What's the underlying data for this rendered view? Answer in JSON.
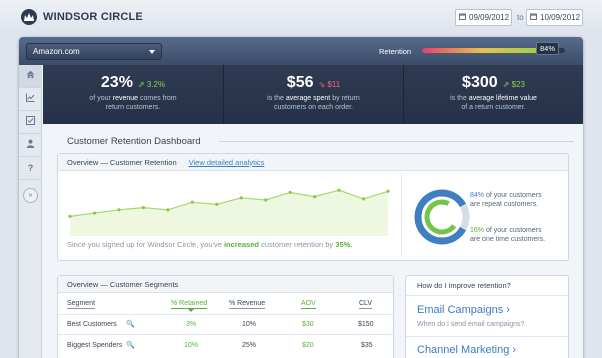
{
  "brand": {
    "name": "WINDSOR CIRCLE"
  },
  "dates": {
    "from": "09/09/2012",
    "to_label": "to",
    "to": "10/09/2012"
  },
  "header": {
    "store": "Amazon.com",
    "retention_label": "Retention",
    "retention_value": "84%",
    "retention_fraction": 0.84
  },
  "sidebar": {
    "icons": [
      "home-icon",
      "chart-icon",
      "checklist-icon",
      "user-icon",
      "help-icon",
      "expand-icon"
    ]
  },
  "stats": [
    {
      "value": "23%",
      "change": "3.2%",
      "line1_pre": "of your",
      "line1_bold": "revenue",
      "line1_post": "comes from",
      "line2": "return customers."
    },
    {
      "value": "$56",
      "change": "$11",
      "line1_pre": "is the",
      "line1_bold": "average spent",
      "line1_post": "by return",
      "line2": "customers on each order."
    },
    {
      "value": "$300",
      "change": "$23",
      "line1_pre": "is the",
      "line1_bold": "average lifetime value",
      "line1_post": "",
      "line2": "of a return customer."
    }
  ],
  "colors": {
    "up": "#8ed14b",
    "down": "#f06a6a",
    "link": "#3d82c4",
    "green": "#5daf3b"
  },
  "dashboard": {
    "title": "Customer Retention Dashboard"
  },
  "overview": {
    "title": "Overview — Customer Retention",
    "link": "View detailed analytics",
    "caption_pre": "Since you signed up for Windsor Circle, you've",
    "caption_bold": "increased",
    "caption_mid": "customer retention by",
    "caption_val": "35%.",
    "repeat_pct": "84%",
    "repeat_text1": "of your customers",
    "repeat_text2": "are repeat customers.",
    "onetime_pct": "16%",
    "onetime_text1": "of your customers",
    "onetime_text2": "are one time customers."
  },
  "chart_data": {
    "type": "area",
    "x": [
      1,
      2,
      3,
      4,
      5,
      6,
      7,
      8,
      9,
      10,
      11,
      12,
      13,
      14
    ],
    "values": [
      38,
      41,
      44,
      46,
      44,
      51,
      49,
      55,
      53,
      60,
      56,
      62,
      54,
      61
    ]
  },
  "donut": {
    "repeat": 0.84,
    "onetime": 0.16
  },
  "segments": {
    "title": "Overview — Customer Segments",
    "headers": [
      "Segment",
      "% Retained",
      "% Revenue",
      "AOV",
      "CLV"
    ],
    "rows": [
      [
        "Best Customers",
        "3%",
        "10%",
        "$30",
        "$150"
      ],
      [
        "Biggest Spenders",
        "10%",
        "25%",
        "$20",
        "$35"
      ]
    ]
  },
  "help": {
    "title": "How do I improve retention?",
    "link1": "Email Campaigns ›",
    "sub1": "When do I send email campaigns?",
    "link2": "Channel Marketing ›"
  }
}
